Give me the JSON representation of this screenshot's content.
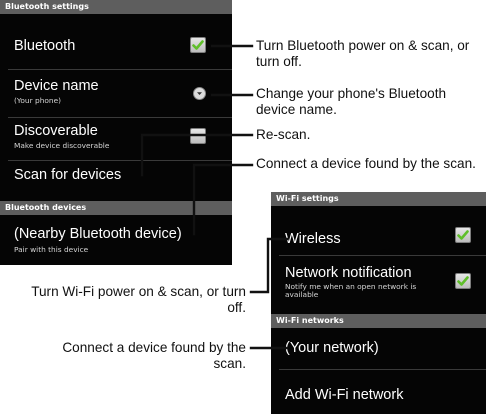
{
  "bluetooth_screen": {
    "settings_header": "Bluetooth settings",
    "bluetooth": {
      "label": "Bluetooth",
      "checked": true
    },
    "device_name": {
      "label": "Device name",
      "value": "(Your phone)"
    },
    "discoverable": {
      "label": "Discoverable",
      "description": "Make device discoverable",
      "checked": false
    },
    "scan": {
      "label": "Scan for devices"
    },
    "devices_header": "Bluetooth devices",
    "nearby_device": {
      "label": "(Nearby Bluetooth device)",
      "description": "Pair with this device"
    }
  },
  "wifi_screen": {
    "settings_header": "Wi-Fi settings",
    "wireless": {
      "label": "Wireless",
      "checked": true
    },
    "network_notification": {
      "label": "Network notification",
      "description": "Notify me when an open network is available",
      "checked": true
    },
    "networks_header": "Wi-Fi networks",
    "your_network": {
      "label": "(Your network)"
    },
    "add_network": {
      "label": "Add Wi-Fi network"
    }
  },
  "callouts": {
    "bluetooth_power": "Turn Bluetooth power on & scan, or turn off.",
    "device_name": "Change your phone's Bluetooth device name.",
    "rescan": "Re-scan.",
    "connect_bt": "Connect a device found by the scan.",
    "wifi_power": "Turn Wi-Fi power on & scan, or turn off.",
    "connect_wifi": "Connect a device found by the scan."
  },
  "colors": {
    "screen_bg": "#050505",
    "header_bg": "#5e5e5e",
    "check_green": "#5fbf2a",
    "leader_line": "#111111"
  }
}
